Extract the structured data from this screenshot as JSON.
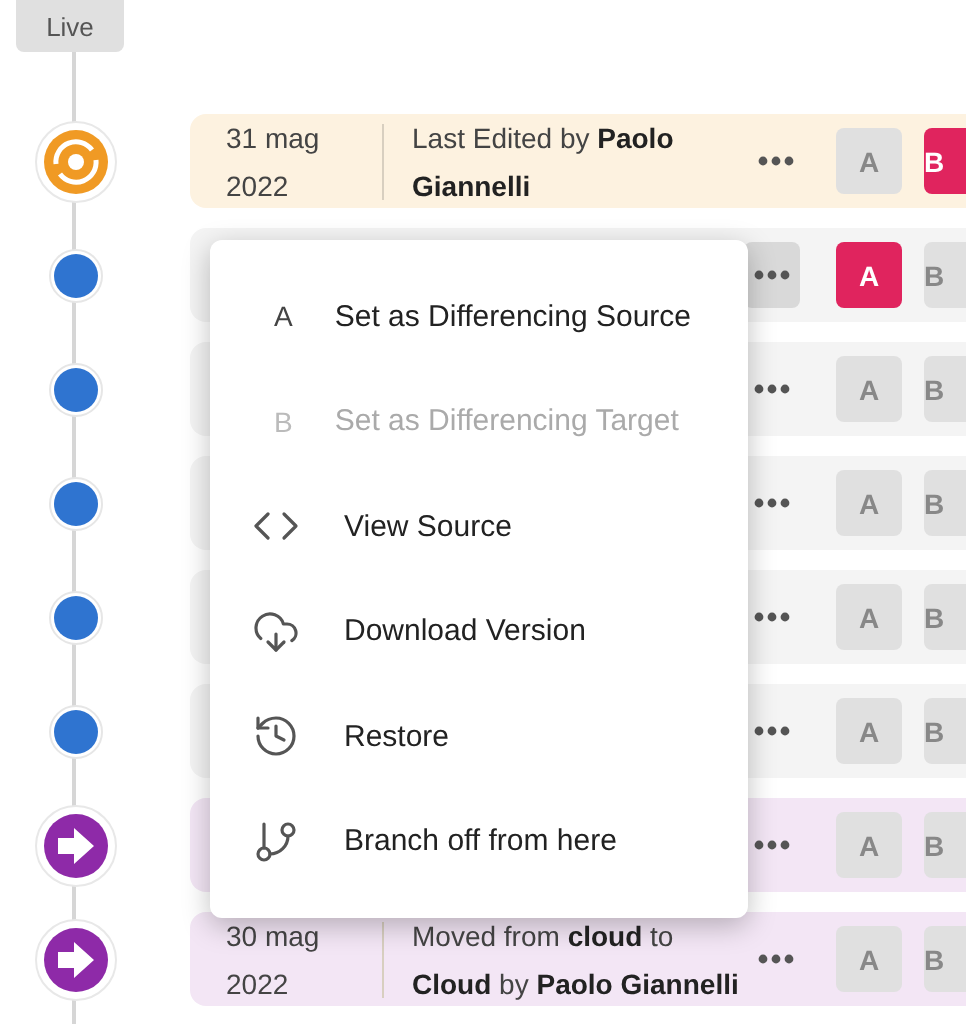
{
  "live_label": "Live",
  "rows": [
    {
      "kind": "edit",
      "date": "31 mag 2022",
      "description": "Last Edited by **Paolo Giannelli**",
      "menu_open": false,
      "a_selected": false,
      "b_selected": true,
      "a_label": "A",
      "b_label": "B"
    },
    {
      "kind": "minor",
      "menu_open": true,
      "a_selected": true,
      "b_selected": false,
      "a_label": "A",
      "b_label": "B"
    },
    {
      "kind": "minor",
      "menu_open": false,
      "a_selected": false,
      "b_selected": false,
      "a_label": "A",
      "b_label": "B"
    },
    {
      "kind": "minor",
      "menu_open": false,
      "a_selected": false,
      "b_selected": false,
      "a_label": "A",
      "b_label": "B"
    },
    {
      "kind": "minor",
      "menu_open": false,
      "a_selected": false,
      "b_selected": false,
      "a_label": "A",
      "b_label": "B"
    },
    {
      "kind": "minor",
      "menu_open": false,
      "a_selected": false,
      "b_selected": false,
      "a_label": "A",
      "b_label": "B"
    },
    {
      "kind": "move",
      "menu_open": false,
      "a_selected": false,
      "b_selected": false,
      "a_label": "A",
      "b_label": "B"
    },
    {
      "kind": "move",
      "date": "30 mag 2022",
      "description": "Moved from **cloud** to **Cloud** by **Paolo Giannelli**",
      "menu_open": false,
      "a_selected": false,
      "b_selected": false,
      "a_label": "A",
      "b_label": "B"
    }
  ],
  "context_menu": {
    "items": [
      {
        "kind": "letter",
        "glyph": "A",
        "label": "Set as Differencing Source",
        "disabled": false
      },
      {
        "kind": "letter",
        "glyph": "B",
        "label": "Set as Differencing Target",
        "disabled": true
      },
      {
        "kind": "code",
        "label": "View Source",
        "disabled": false
      },
      {
        "kind": "download",
        "label": "Download Version",
        "disabled": false
      },
      {
        "kind": "restore",
        "label": "Restore",
        "disabled": false
      },
      {
        "kind": "branch",
        "label": "Branch off from here",
        "disabled": false
      }
    ]
  }
}
